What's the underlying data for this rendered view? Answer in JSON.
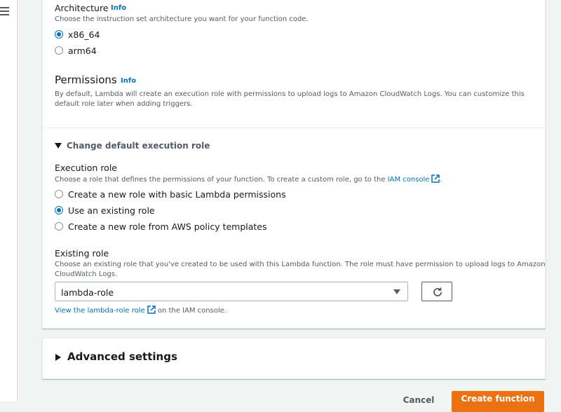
{
  "architecture": {
    "label": "Architecture",
    "info": "Info",
    "description": "Choose the instruction set architecture you want for your function code.",
    "options": [
      {
        "label": "x86_64",
        "selected": true
      },
      {
        "label": "arm64",
        "selected": false
      }
    ]
  },
  "permissions": {
    "label": "Permissions",
    "info": "Info",
    "description_line1": "By default, Lambda will create an execution role with permissions to upload logs to Amazon CloudWatch Logs. You can customize this",
    "description_line2": "default role later when adding triggers."
  },
  "execution_role_section": {
    "toggle_label": "Change default execution role",
    "expanded": true,
    "execution_role": {
      "label": "Execution role",
      "description": "Choose a role that defines the permissions of your function. To create a custom role, go to the",
      "link_text": "IAM console",
      "suffix": ".",
      "options": [
        {
          "label": "Create a new role with basic Lambda permissions",
          "selected": false
        },
        {
          "label": "Use an existing role",
          "selected": true
        },
        {
          "label": "Create a new role from AWS policy templates",
          "selected": false
        }
      ]
    },
    "existing_role": {
      "label": "Existing role",
      "description_line1": "Choose an existing role that you've created to be used with this Lambda function. The role must have permission to upload logs to Amazon",
      "description_line2": "CloudWatch Logs.",
      "selected_value": "lambda-role",
      "view_link": "View the lambda-role role",
      "view_suffix": "on the IAM console."
    }
  },
  "advanced_settings": {
    "label": "Advanced settings",
    "expanded": false
  },
  "footer": {
    "cancel_label": "Cancel",
    "create_label": "Create function"
  },
  "colors": {
    "accent": "#0073bb",
    "primary_button": "#ec7211",
    "background": "#f2f3f3"
  }
}
